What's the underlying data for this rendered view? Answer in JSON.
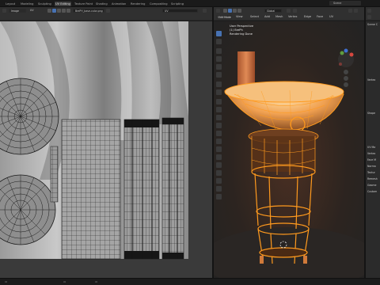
{
  "workspace_tabs": [
    "Layout",
    "Modeling",
    "Sculpting",
    "UV Editing",
    "Texture Paint",
    "Shading",
    "Animation",
    "Rendering",
    "Compositing",
    "Scripting"
  ],
  "active_tab_index": 3,
  "scene_name": "Scene",
  "uv_editor": {
    "editor_type_label": "Image",
    "uv_menu_label": "UV",
    "image_name": "BrePH_base-color.png",
    "uv_map_label": "UV"
  },
  "viewport": {
    "mode_label": "Edit Mode",
    "menu_items": [
      "View",
      "Select",
      "Add",
      "Mesh",
      "Vertex",
      "Edge",
      "Face",
      "UV"
    ],
    "transform_label": "Global",
    "info_lines": [
      "User Perspective",
      "(1) BrePh",
      "Rendering Done"
    ]
  },
  "properties": {
    "rows": [
      "Scene C",
      "Vertex",
      "Shape",
      "UV Ma",
      "Vertex",
      "Face M",
      "Norma",
      "Textur",
      "Remesh",
      "Geome",
      "Custom"
    ]
  },
  "colors": {
    "accent": "#4772b3",
    "selection_orange": "#ff9a1e",
    "uv_wire": "#1e1e1e"
  }
}
